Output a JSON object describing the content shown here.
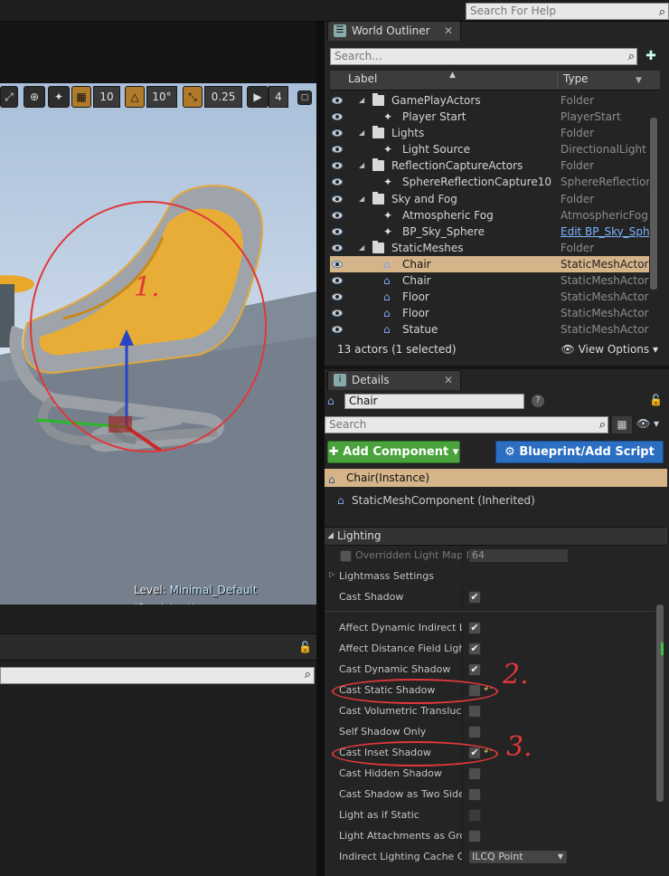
{
  "help": {
    "search_placeholder": "Search For Help"
  },
  "viewport": {
    "toolbar": {
      "grid_snap": "10",
      "rotation_snap": "10°",
      "scale_snap": "0.25",
      "camera_speed": "4"
    },
    "level_prefix": "Level:",
    "level_name": "Minimal_Default (Persistent)"
  },
  "outliner": {
    "tab_title": "World Outliner",
    "tab_close": "✕",
    "search_placeholder": "Search...",
    "col_label": "Label",
    "col_type": "Type",
    "rows": [
      {
        "name": "GamePlayActors",
        "type": "Folder",
        "indent": 0,
        "kind": "folder",
        "selected": false
      },
      {
        "name": "Player Start",
        "type": "PlayerStart",
        "indent": 1,
        "kind": "actor",
        "selected": false
      },
      {
        "name": "Lights",
        "type": "Folder",
        "indent": 0,
        "kind": "folder",
        "selected": false
      },
      {
        "name": "Light Source",
        "type": "DirectionalLight",
        "indent": 1,
        "kind": "actor",
        "selected": false
      },
      {
        "name": "ReflectionCaptureActors",
        "type": "Folder",
        "indent": 0,
        "kind": "folder",
        "selected": false
      },
      {
        "name": "SphereReflectionCapture10",
        "type": "SphereReflectionC",
        "indent": 1,
        "kind": "actor",
        "selected": false
      },
      {
        "name": "Sky and Fog",
        "type": "Folder",
        "indent": 0,
        "kind": "folder",
        "selected": false
      },
      {
        "name": "Atmospheric Fog",
        "type": "AtmosphericFog",
        "indent": 1,
        "kind": "actor",
        "selected": false
      },
      {
        "name": "BP_Sky_Sphere",
        "type": "Edit BP_Sky_Sph",
        "indent": 1,
        "kind": "actor",
        "selected": false,
        "link": true
      },
      {
        "name": "StaticMeshes",
        "type": "Folder",
        "indent": 0,
        "kind": "folder",
        "selected": false
      },
      {
        "name": "Chair",
        "type": "StaticMeshActor",
        "indent": 1,
        "kind": "mesh",
        "selected": true
      },
      {
        "name": "Chair",
        "type": "StaticMeshActor",
        "indent": 1,
        "kind": "mesh",
        "selected": false
      },
      {
        "name": "Floor",
        "type": "StaticMeshActor",
        "indent": 1,
        "kind": "mesh",
        "selected": false
      },
      {
        "name": "Floor",
        "type": "StaticMeshActor",
        "indent": 1,
        "kind": "mesh",
        "selected": false
      },
      {
        "name": "Statue",
        "type": "StaticMeshActor",
        "indent": 1,
        "kind": "mesh",
        "selected": false
      }
    ],
    "status": "13 actors (1 selected)",
    "view_options": "View Options"
  },
  "details": {
    "tab_title": "Details",
    "tab_close": "✕",
    "object_name": "Chair",
    "search_placeholder": "Search",
    "add_component": "Add Component",
    "blueprint_script": "Blueprint/Add Script",
    "components": {
      "instance": "Chair(Instance)",
      "inherited": "StaticMeshComponent (Inherited)"
    },
    "section": "Lighting",
    "properties": [
      {
        "label": "Overridden Light Map R",
        "control": "value",
        "value": "64",
        "dim": true,
        "lead_check": true
      },
      {
        "label": "Lightmass Settings",
        "control": "none",
        "expandable": true
      },
      {
        "label": "Cast Shadow",
        "control": "check",
        "checked": true
      },
      {
        "label": "Affect Dynamic Indirect Lig",
        "control": "check",
        "checked": true
      },
      {
        "label": "Affect Distance Field Lighti",
        "control": "check",
        "checked": true
      },
      {
        "label": "Cast Dynamic Shadow",
        "control": "check",
        "checked": true
      },
      {
        "label": "Cast Static Shadow",
        "control": "check",
        "checked": false,
        "reset": true
      },
      {
        "label": "Cast Volumetric Transluce",
        "control": "check",
        "checked": false
      },
      {
        "label": "Self Shadow Only",
        "control": "check",
        "checked": false
      },
      {
        "label": "Cast Inset Shadow",
        "control": "check",
        "checked": true,
        "reset": true
      },
      {
        "label": "Cast Hidden Shadow",
        "control": "check",
        "checked": false
      },
      {
        "label": "Cast Shadow as Two Sided",
        "control": "check",
        "checked": false
      },
      {
        "label": "Light as if Static",
        "control": "check",
        "checked": false,
        "disabled": true
      },
      {
        "label": "Light Attachments as Group",
        "control": "check",
        "checked": false
      },
      {
        "label": "Indirect Lighting Cache Qua",
        "control": "combo",
        "value": "ILCQ Point"
      }
    ]
  },
  "annotations": {
    "one": "1.",
    "two": "2.",
    "three": "3."
  },
  "colors": {
    "selection": "#d5b48a",
    "add_component": "#49a23b",
    "blueprint": "#2b6ec2",
    "annotation": "#e0383a"
  }
}
